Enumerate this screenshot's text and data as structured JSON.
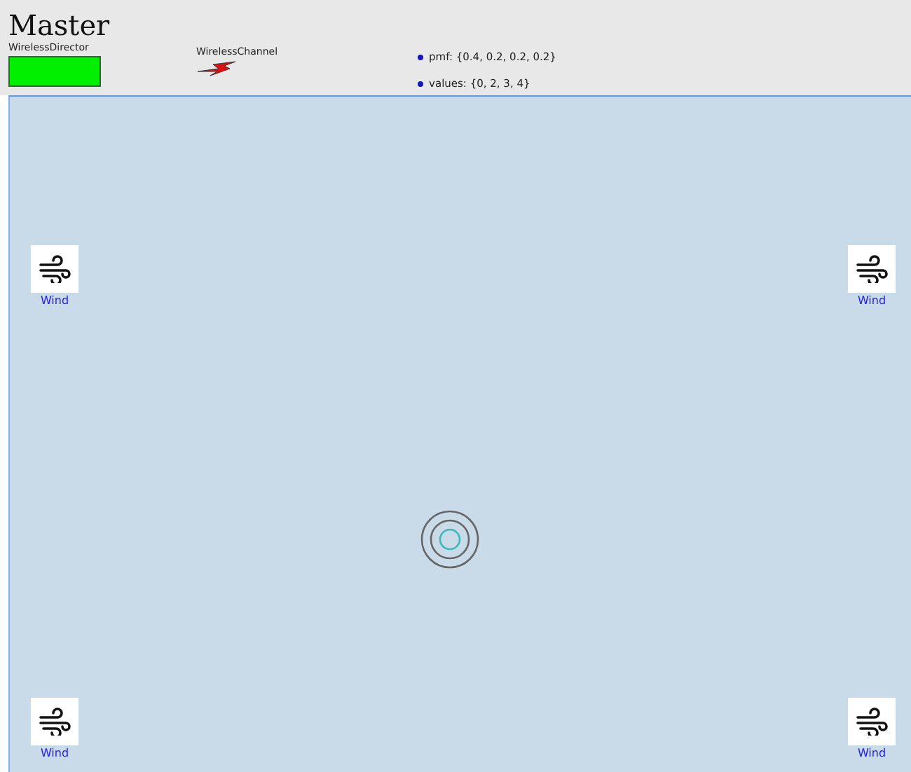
{
  "title": "Master",
  "director": {
    "label": "WirelessDirector"
  },
  "channel": {
    "label": "WirelessChannel"
  },
  "parameters": [
    "pmf: {0.4, 0.2, 0.2, 0.2}",
    "values: {0, 2, 3, 4}"
  ],
  "actors": [
    {
      "label": "Wind"
    },
    {
      "label": "Wind"
    },
    {
      "label": "Wind"
    },
    {
      "label": "Wind"
    }
  ]
}
